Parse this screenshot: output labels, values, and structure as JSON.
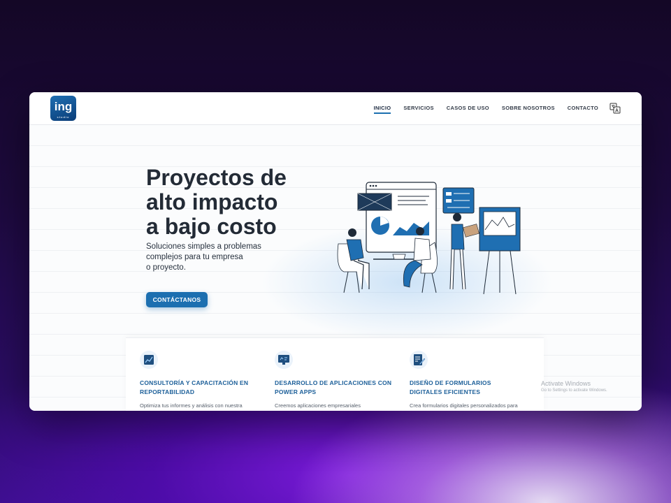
{
  "logo": {
    "text": "ing",
    "subtext": "studio"
  },
  "nav": {
    "items": [
      {
        "label": "INICIO",
        "active": true
      },
      {
        "label": "SERVICIOS",
        "active": false
      },
      {
        "label": "CASOS DE USO",
        "active": false
      },
      {
        "label": "SOBRE NOSOTROS",
        "active": false
      },
      {
        "label": "CONTACTO",
        "active": false
      }
    ],
    "language_icon": "translate-icon"
  },
  "hero": {
    "title_lines": [
      "Proyectos de",
      "alto impacto",
      "a bajo costo"
    ],
    "subtitle_lines": [
      "Soluciones simples a problemas",
      "complejos para tu empresa",
      "o proyecto."
    ],
    "cta_label": "CONTÁCTANOS",
    "illustration": "team-meeting-dashboard-illustration"
  },
  "services": [
    {
      "icon": "report-chart-icon",
      "title_lines": [
        "CONSULTORÍA Y CAPACITACIÓN EN",
        "REPORTABILIDAD"
      ],
      "description": "Optimiza tus informes y análisis con nuestra"
    },
    {
      "icon": "monitor-app-icon",
      "title_lines": [
        "DESARROLLO DE APLICACIONES CON",
        "POWER APPS"
      ],
      "description": "Creemos aplicaciones empresariales"
    },
    {
      "icon": "form-edit-icon",
      "title_lines": [
        "DISEÑO DE FORMULARIOS",
        "DIGITALES EFICIENTES"
      ],
      "description": "Crea formularios digitales personalizados para"
    }
  ],
  "watermark": {
    "title": "Activate Windows",
    "subtitle": "Go to Settings to activate Windows."
  },
  "colors": {
    "accent": "#1c6fb0",
    "title": "#232b36",
    "service_title": "#1c5f99"
  }
}
